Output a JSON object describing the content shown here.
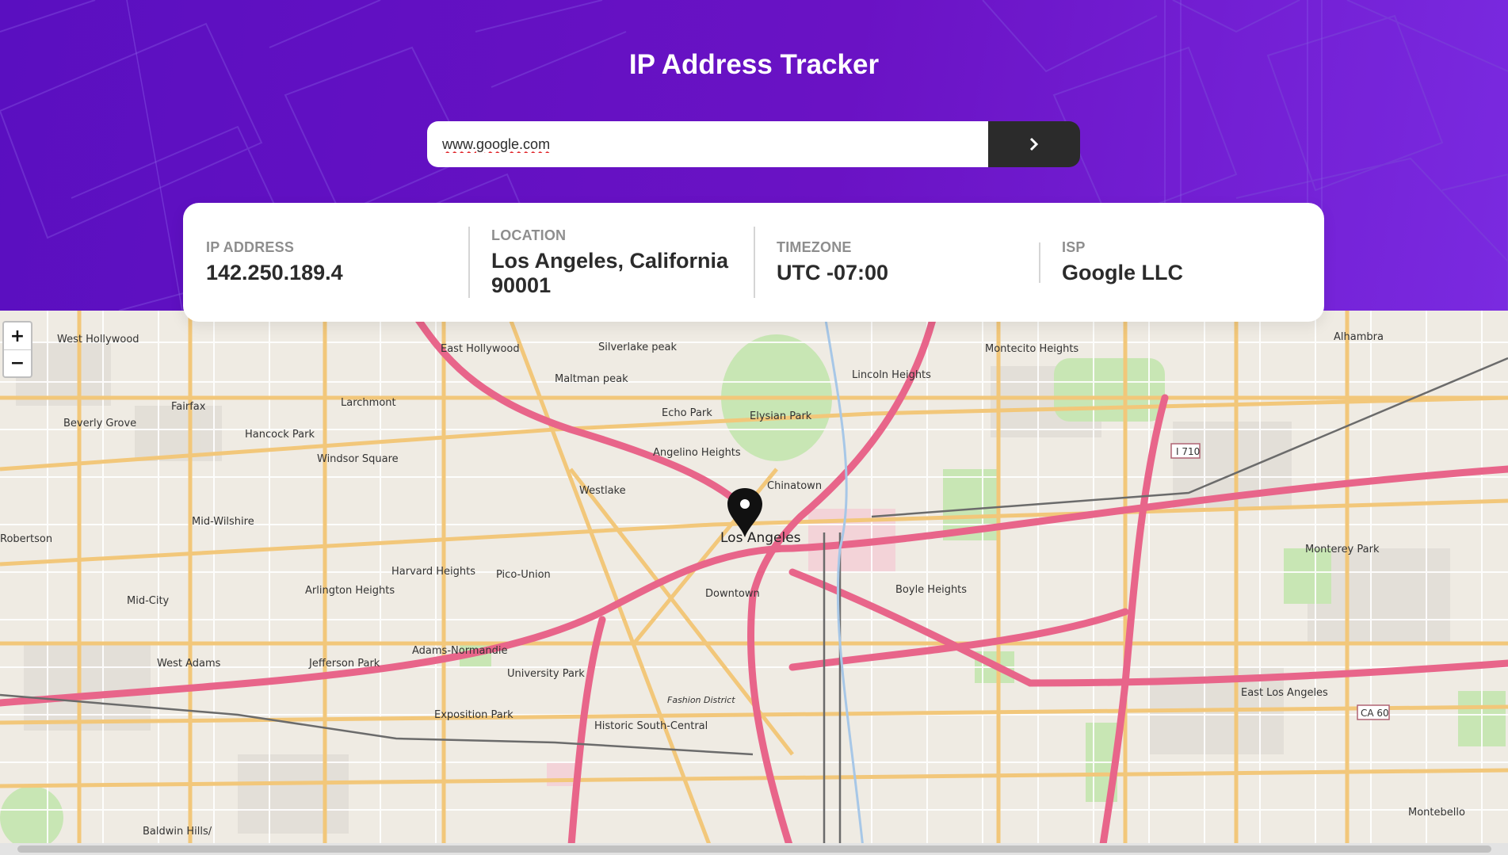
{
  "app": {
    "title": "IP Address Tracker"
  },
  "search": {
    "value": "www.google.com",
    "submit_icon": "chevron-right-icon"
  },
  "info": {
    "ip": {
      "label": "IP ADDRESS",
      "value": "142.250.189.4"
    },
    "location": {
      "label": "LOCATION",
      "value_line1": "Los Angeles, California",
      "value_line2": "90001"
    },
    "timezone": {
      "label": "TIMEZONE",
      "value": "UTC -07:00"
    },
    "isp": {
      "label": "ISP",
      "value": "Google LLC"
    }
  },
  "map": {
    "zoom_in": "+",
    "zoom_out": "−",
    "marker_icon": "location-pin-icon",
    "labels": [
      "West Hollywood",
      "East Hollywood",
      "Silverlake peak",
      "Maltman peak",
      "Lincoln Heights",
      "Montecito Heights",
      "Alhambra",
      "Fairfax",
      "Larchmont",
      "Beverly Grove",
      "Echo Park",
      "Elysian Park",
      "Hancock Park",
      "Windsor Square",
      "Angelino Heights",
      "Chinatown",
      "Westlake",
      "Mid-Wilshire",
      "Los Angeles",
      "Monterey Park",
      "Harvard Heights",
      "Pico-Union",
      "Arlington Heights",
      "Mid-City",
      "Downtown",
      "Boyle Heights",
      "Adams-Normandie",
      "West Adams",
      "Jefferson Park",
      "University Park",
      "East Los Angeles",
      "Exposition Park",
      "Historic South-Central",
      "Baldwin Hills/",
      "Montebello",
      "Robertson",
      "Fashion District",
      "I 710",
      "CA 60"
    ]
  },
  "colors": {
    "header_start": "#5a0fc0",
    "header_end": "#7a2ae0",
    "button_bg": "#2b2b2b",
    "label_gray": "#8e8e8e",
    "value_dark": "#2b2b2b",
    "motorway": "#e8658a",
    "primary_road": "#f2c77a"
  }
}
